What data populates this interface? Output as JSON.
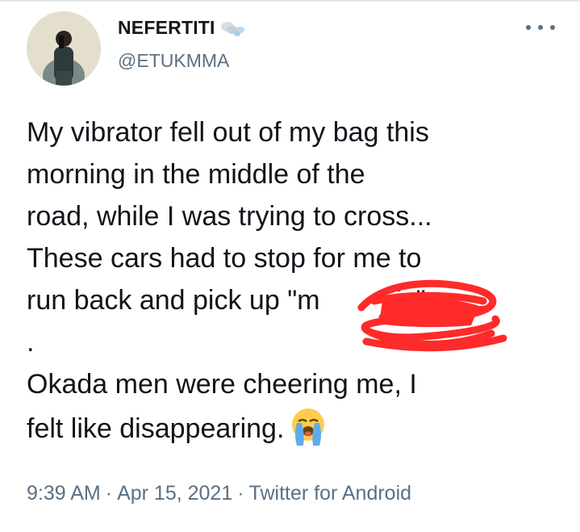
{
  "tweet": {
    "author": {
      "display_name": "NEFERTITI",
      "name_emoji": "dash-emoji",
      "handle": "@ETUKMMA",
      "avatar_icon": "profile-photo"
    },
    "more_icon": "more-dots-icon",
    "text_lines": [
      "My vibrator fell out of my bag this",
      "morning in the middle of the",
      "road, while I was trying to cross...",
      "These cars had to stop for me to",
      "run back and pick up \"",
      ".",
      "Okada men were cheering me, I",
      "felt like disappearing."
    ],
    "redacted_visible_fragment": "m          is",
    "line5_close": "\".",
    "end_emoji": "loudly-crying-face-emoji",
    "redaction_color": "#ff2a2a",
    "meta": {
      "time": "9:39 AM",
      "separator": "·",
      "date": "Apr 15, 2021",
      "source": "Twitter for Android"
    }
  }
}
